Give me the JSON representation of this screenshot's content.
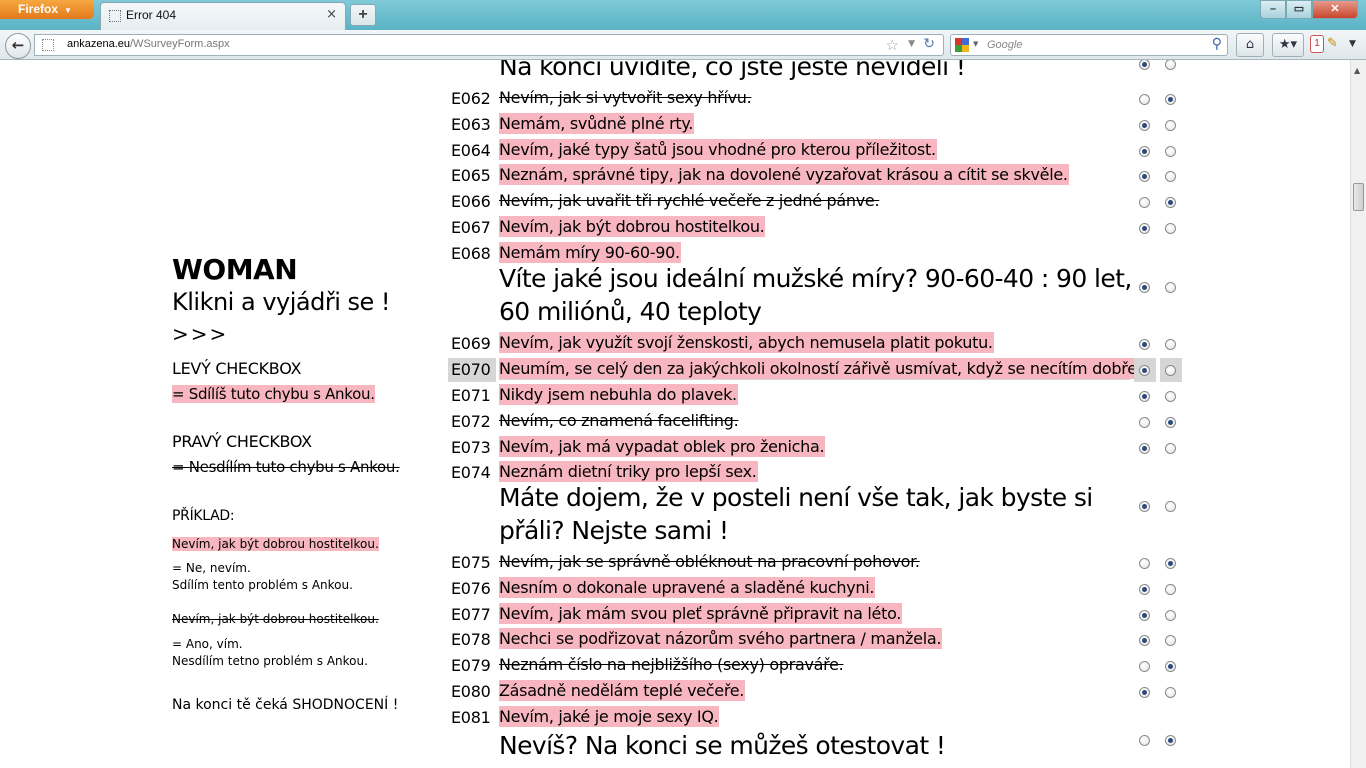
{
  "browser": {
    "app_button": "Firefox",
    "tab_title": "Error 404",
    "url_domain": "ankazena.eu",
    "url_path": "/WSurveyForm.aspx",
    "search_placeholder": "Google",
    "addon_badge": "1"
  },
  "sidebar": {
    "title": "WOMAN",
    "subtitle": "Klikni a vyjádři se !",
    "arrows": ">>>",
    "left_checkbox_heading": "LEVÝ CHECKBOX",
    "left_checkbox_meaning": "= Sdílíš tuto chybu s Ankou.",
    "right_checkbox_heading": "PRAVÝ CHECKBOX",
    "right_checkbox_meaning": "= Nesdílím tuto chybu s Ankou.",
    "example_heading": "PŘÍKLAD:",
    "example1_statement": "Nevím, jak být dobrou hostitelkou.",
    "example1_answer_line1": "= Ne, nevím.",
    "example1_answer_line2": "Sdílím tento problém s Ankou.",
    "example2_statement": "Nevím, jak být dobrou hostitelkou.",
    "example2_answer_line1": "= Ano, vím.",
    "example2_answer_line2": "Nesdílím tetno problém s Ankou.",
    "footer": "Na konci tě čeká SHODNOCENÍ !"
  },
  "survey": {
    "top_banner": "Na konci uvidíte, co jste ještě neviděli !",
    "top_banner_selected": "left",
    "items": [
      {
        "code": "E062",
        "text": "Nevím, jak si vytvořit sexy hřívu.",
        "selected": "right"
      },
      {
        "code": "E063",
        "text": "Nemám, svůdně plné rty.",
        "selected": "left"
      },
      {
        "code": "E064",
        "text": "Nevím, jaké typy šatů jsou vhodné pro kterou příležitost.",
        "selected": "left"
      },
      {
        "code": "E065",
        "text": "Neznám, správné tipy, jak na dovolené vyzařovat krásou a cítit se skvěle.",
        "selected": "left"
      },
      {
        "code": "E066",
        "text": "Nevím, jak uvařit tři rychlé večeře z jedné pánve.",
        "selected": "right"
      },
      {
        "code": "E067",
        "text": "Nevím, jak být dobrou hostitelkou.",
        "selected": "left"
      },
      {
        "code": "E068",
        "text": "Nemám míry 90-60-90.",
        "selected": "none"
      }
    ],
    "banner1": "Víte jaké jsou ideální mužské míry? 90-60-40 : 90 let, 60 miliónů, 40 teploty",
    "banner1_selected": "left",
    "items2": [
      {
        "code": "E069",
        "text": "Nevím, jak využít svojí ženskosti, abych nemusela platit pokutu.",
        "selected": "left"
      },
      {
        "code": "E070",
        "text": "Neumím, se celý den za jakýchkoli okolností zářivě usmívat, když se necítím dobře.",
        "selected": "left"
      },
      {
        "code": "E071",
        "text": "Nikdy jsem nebuhla do plavek.",
        "selected": "left"
      },
      {
        "code": "E072",
        "text": "Nevím, co znamená facelifting.",
        "selected": "right"
      },
      {
        "code": "E073",
        "text": "Nevím, jak má vypadat oblek pro ženicha.",
        "selected": "left"
      },
      {
        "code": "E074",
        "text": "Neznám dietní triky pro lepší sex.",
        "selected": "none"
      }
    ],
    "banner2": "Máte dojem, že v posteli není vše tak, jak byste si přáli? Nejste sami !",
    "banner2_selected": "left",
    "items3": [
      {
        "code": "E075",
        "text": "Nevím, jak se správně obléknout na pracovní pohovor.",
        "selected": "right"
      },
      {
        "code": "E076",
        "text": "Nesním o dokonale upravené a sladěné kuchyni.",
        "selected": "left"
      },
      {
        "code": "E077",
        "text": "Nevím, jak mám svou pleť správně připravit na léto.",
        "selected": "left"
      },
      {
        "code": "E078",
        "text": "Nechci se podřizovat názorům svého partnera / manžela.",
        "selected": "left"
      },
      {
        "code": "E079",
        "text": "Neznám číslo na nejbližšího (sexy) opraváře.",
        "selected": "right"
      },
      {
        "code": "E080",
        "text": "Zásadně nedělám teplé večeře.",
        "selected": "left"
      },
      {
        "code": "E081",
        "text": "Nevím, jaké je moje sexy IQ.",
        "selected": "none"
      }
    ],
    "banner3": "Nevíš? Na konci se můžeš otestovat !",
    "banner3_selected": "right",
    "highlighted_code": "E070"
  },
  "colors": {
    "shared_highlight": "#f8b6c0",
    "row_highlight": "#d6d6d6",
    "tabbar": "#6cc0cf"
  }
}
